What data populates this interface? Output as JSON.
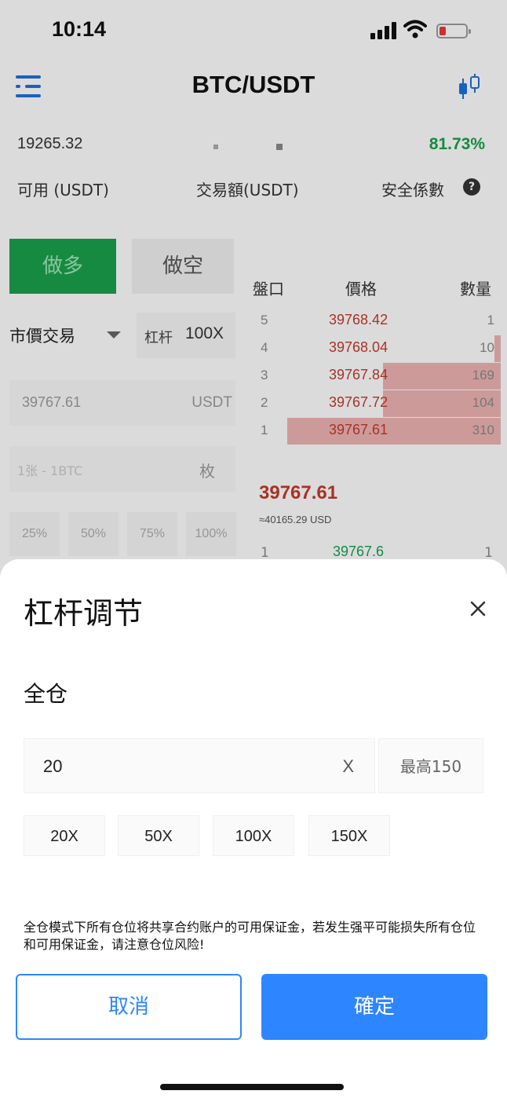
{
  "status_bar": {
    "time": "10:14"
  },
  "header": {
    "title": "BTC/USDT",
    "icons": [
      "menu-icon",
      "candlestick-chart-icon"
    ]
  },
  "account": {
    "balance": "19265.32",
    "safety_value": "81.73%",
    "available_label": "可用 (USDT)",
    "volume_label": "交易額(USDT)",
    "safety_label": "安全係數"
  },
  "trade": {
    "long_label": "做多",
    "short_label": "做空",
    "order_type": "市價交易",
    "leverage_label": "杠杆",
    "leverage_value": "100X",
    "price_value": "39767.61",
    "price_unit": "USDT",
    "qty_placeholder": "1张 - 1BTC",
    "qty_unit": "枚",
    "percents": [
      "25%",
      "50%",
      "75%",
      "100%"
    ]
  },
  "orderbook": {
    "headers": [
      "盤口",
      "價格",
      "數量"
    ],
    "asks": [
      {
        "level": "5",
        "price": "39768.42",
        "qty": "1",
        "depth": 0.0
      },
      {
        "level": "4",
        "price": "39768.04",
        "qty": "10",
        "depth": 0.03
      },
      {
        "level": "3",
        "price": "39767.84",
        "qty": "169",
        "depth": 0.55
      },
      {
        "level": "2",
        "price": "39767.72",
        "qty": "104",
        "depth": 0.55
      },
      {
        "level": "1",
        "price": "39767.61",
        "qty": "310",
        "depth": 1.0
      }
    ],
    "last_price": "39767.61",
    "last_usd": "≈40165.29 USD",
    "bid": {
      "level": "1",
      "price": "39767.6",
      "qty": "1"
    }
  },
  "sheet": {
    "title": "杠杆调节",
    "mode_label": "全仓",
    "input_value": "20",
    "input_suffix": "X",
    "max_label": "最高150",
    "presets": [
      "20X",
      "50X",
      "100X",
      "150X"
    ],
    "warning": "全仓模式下所有仓位将共享合约账户的可用保证金，若发生强平可能损失所有仓位和可用保证金，请注意仓位风险!",
    "cancel_label": "取消",
    "confirm_label": "確定"
  },
  "colors": {
    "accent": "#2d86ff",
    "long": "#1a9e4b",
    "ask": "#c0392b",
    "ask_bar": "#eab0b0"
  }
}
